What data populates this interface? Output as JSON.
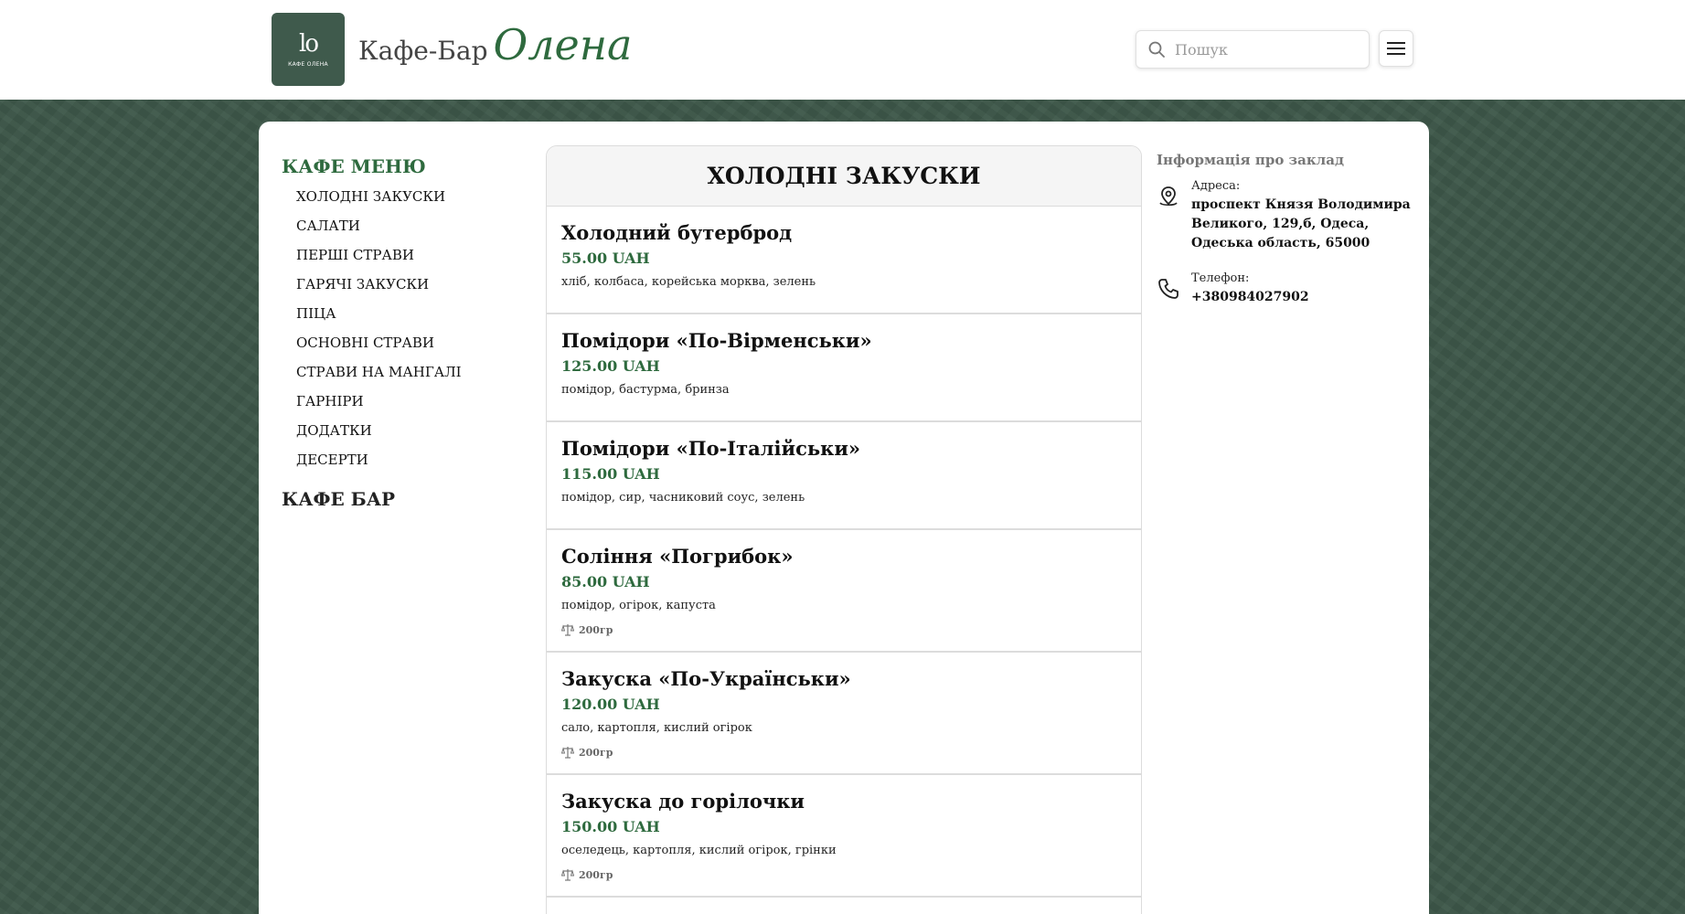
{
  "header": {
    "logo_mono": "lo",
    "logo_small": "КАФЕ ОЛЕНА",
    "brand_prefix": "Кафе-Бар",
    "brand_script": "Олена",
    "search_placeholder": "Пошук",
    "menu_icon": "hamburger-icon"
  },
  "colors": {
    "accent": "#2e6a3e",
    "background": "#3d5749",
    "logo_bg": "#3f5a4c"
  },
  "sidebar": {
    "heading": "КАФЕ МЕНЮ",
    "items": [
      {
        "label": "ХОЛОДНІ ЗАКУСКИ"
      },
      {
        "label": "САЛАТИ"
      },
      {
        "label": "ПЕРШІ СТРАВИ"
      },
      {
        "label": "ГАРЯЧІ ЗАКУСКИ"
      },
      {
        "label": "ПІЦА"
      },
      {
        "label": "ОСНОВНІ СТРАВИ"
      },
      {
        "label": "СТРАВИ НА МАНГАЛІ"
      },
      {
        "label": "ГАРНІРИ"
      },
      {
        "label": "ДОДАТКИ"
      },
      {
        "label": "ДЕСЕРТИ"
      }
    ],
    "heading2": "КАФЕ БАР"
  },
  "menu": {
    "title": "ХОЛОДНІ ЗАКУСКИ",
    "items": [
      {
        "name": "Холодний бутерброд",
        "price": "55.00 UAH",
        "desc": "хліб, колбаса, корейська морква, зелень"
      },
      {
        "name": "Помідори «По-Вірменськи»",
        "price": "125.00 UAH",
        "desc": "помідор, бастурма, бринза"
      },
      {
        "name": "Помідори «По-Італійськи»",
        "price": "115.00 UAH",
        "desc": "помідор, сир, часниковий соус, зелень"
      },
      {
        "name": "Соління «Погрибок»",
        "price": "85.00 UAH",
        "desc": "помідор, огірок, капуста",
        "weight": "200гр"
      },
      {
        "name": "Закуска «По-Українськи»",
        "price": "120.00 UAH",
        "desc": "сало, картопля, кислий огірок",
        "weight": "200гр"
      },
      {
        "name": "Закуска до горілочки",
        "price": "150.00 UAH",
        "desc": "оселедець, картопля, кислий огірок, грінки",
        "weight": "200гр"
      }
    ]
  },
  "info": {
    "title": "Інформація про заклад",
    "address_label": "Адреса:",
    "address_value": "проспект Князя Володимира Великого, 129,б, Одеса, Одеська область, 65000",
    "phone_label": "Телефон:",
    "phone_value": "+380984027902"
  }
}
